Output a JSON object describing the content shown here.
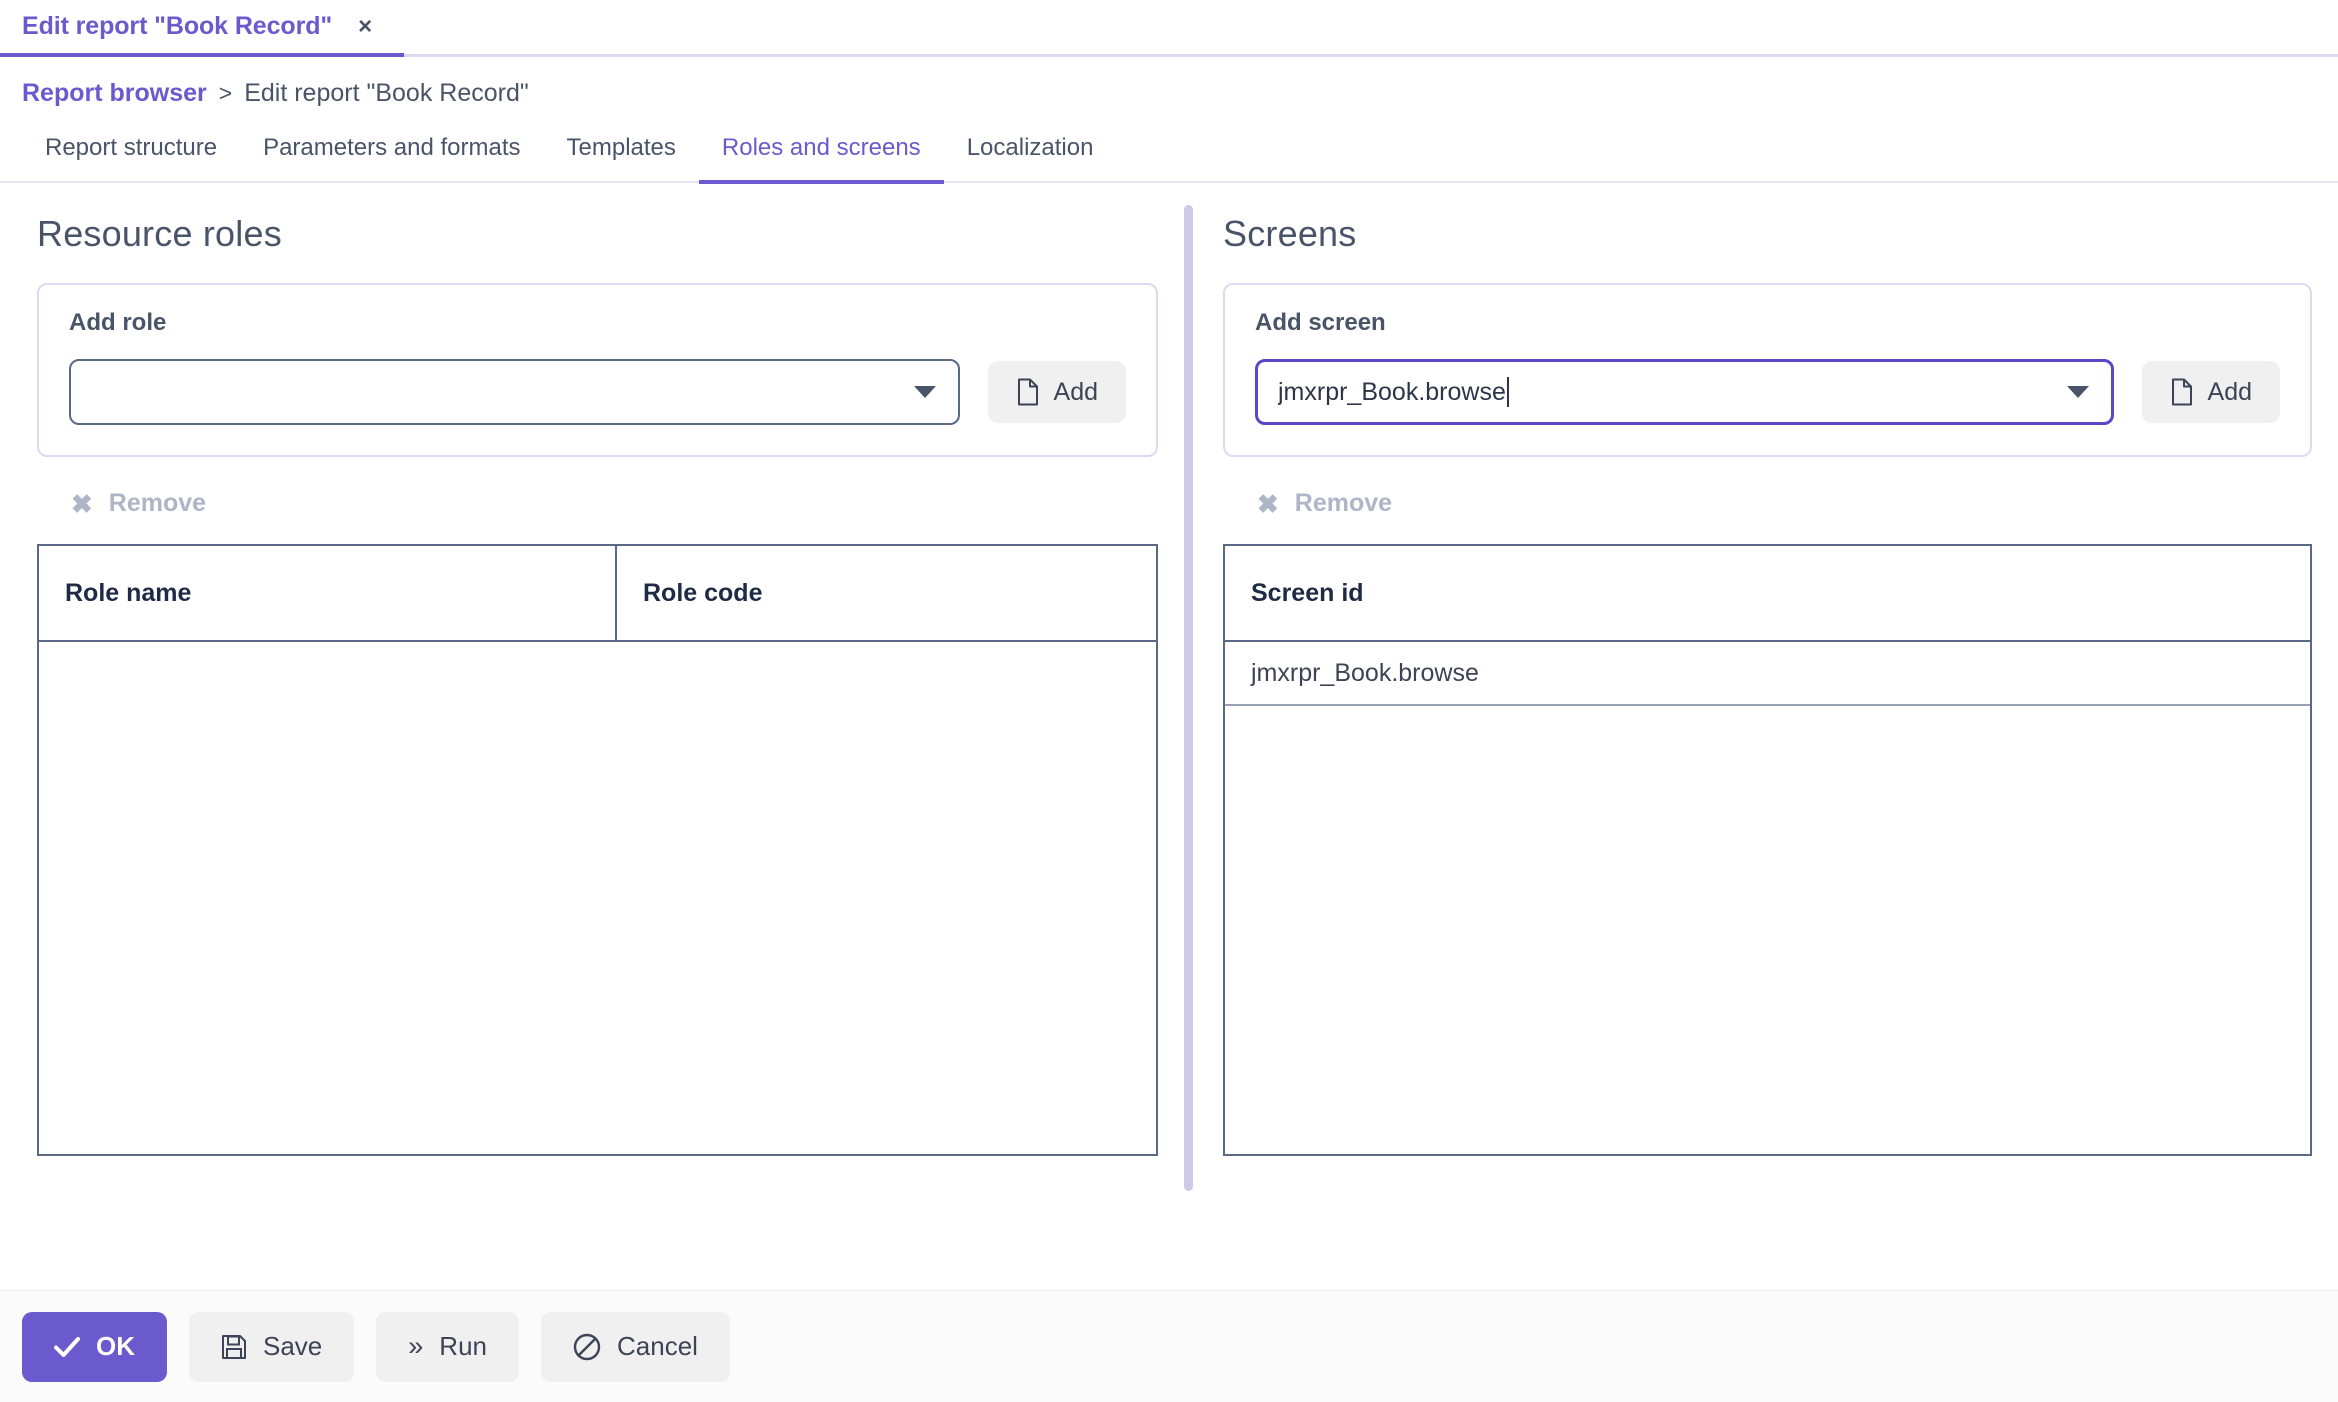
{
  "window_tab": {
    "title": "Edit report \"Book Record\"",
    "close_icon": "close-icon",
    "close_glyph": "×"
  },
  "breadcrumb": {
    "root": "Report browser",
    "separator": ">",
    "current": "Edit report \"Book Record\""
  },
  "section_tabs": [
    {
      "label": "Report structure",
      "active": false
    },
    {
      "label": "Parameters and formats",
      "active": false
    },
    {
      "label": "Templates",
      "active": false
    },
    {
      "label": "Roles and screens",
      "active": true
    },
    {
      "label": "Localization",
      "active": false
    }
  ],
  "resource_roles": {
    "title": "Resource roles",
    "add_box": {
      "label": "Add role",
      "combo_value": "",
      "combo_placeholder": "",
      "combo_focused": false,
      "arrow_icon": "chevron-down-icon",
      "add_button": {
        "label": "Add",
        "icon": "document-icon"
      }
    },
    "remove_button": {
      "label": "Remove",
      "icon": "x-icon",
      "glyph": "✖",
      "disabled": true
    },
    "table": {
      "columns": [
        "Role name",
        "Role code"
      ],
      "rows": []
    }
  },
  "screens": {
    "title": "Screens",
    "add_box": {
      "label": "Add screen",
      "combo_value": "jmxrpr_Book.browse",
      "combo_placeholder": "",
      "combo_focused": true,
      "arrow_icon": "chevron-down-icon",
      "add_button": {
        "label": "Add",
        "icon": "document-icon"
      }
    },
    "remove_button": {
      "label": "Remove",
      "icon": "x-icon",
      "glyph": "✖",
      "disabled": true
    },
    "table": {
      "columns": [
        "Screen id"
      ],
      "rows": [
        {
          "screen_id": "jmxrpr_Book.browse"
        }
      ]
    }
  },
  "footer": {
    "ok": {
      "label": "OK",
      "icon": "check-icon"
    },
    "save": {
      "label": "Save",
      "icon": "floppy-disk-icon"
    },
    "run": {
      "label": "Run",
      "icon": "double-chevron-right-icon",
      "glyph": "»"
    },
    "cancel": {
      "label": "Cancel",
      "icon": "ban-icon"
    }
  },
  "colors": {
    "accent": "#6a5acd",
    "focus_border": "#5b46c4",
    "text": "#4a5468",
    "grid_border": "#5a6a85",
    "disabled_text": "#adb5c7",
    "divider": "#cfc9e8"
  }
}
